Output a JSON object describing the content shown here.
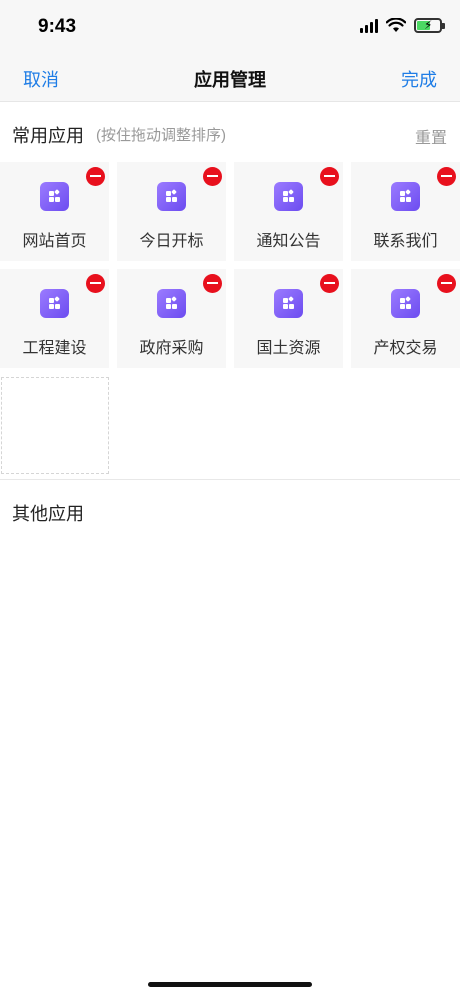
{
  "status": {
    "time": "9:43"
  },
  "nav": {
    "cancel": "取消",
    "title": "应用管理",
    "done": "完成"
  },
  "common_section": {
    "title": "常用应用",
    "hint": "(按住拖动调整排序)",
    "reset": "重置"
  },
  "common_apps": [
    {
      "label": "网站首页"
    },
    {
      "label": "今日开标"
    },
    {
      "label": "通知公告"
    },
    {
      "label": "联系我们"
    },
    {
      "label": "工程建设"
    },
    {
      "label": "政府采购"
    },
    {
      "label": "国土资源"
    },
    {
      "label": "产权交易"
    }
  ],
  "other_section": {
    "title": "其他应用"
  },
  "colors": {
    "accent": "#1f7de6",
    "remove": "#e8101d",
    "icon_gradient_start": "#9b7bff",
    "icon_gradient_end": "#6c4cf0"
  },
  "icons": {
    "app": "app-grid-icon",
    "remove": "minus-circle-icon",
    "signal": "cellular-signal-icon",
    "wifi": "wifi-icon",
    "battery": "battery-charging-icon"
  }
}
